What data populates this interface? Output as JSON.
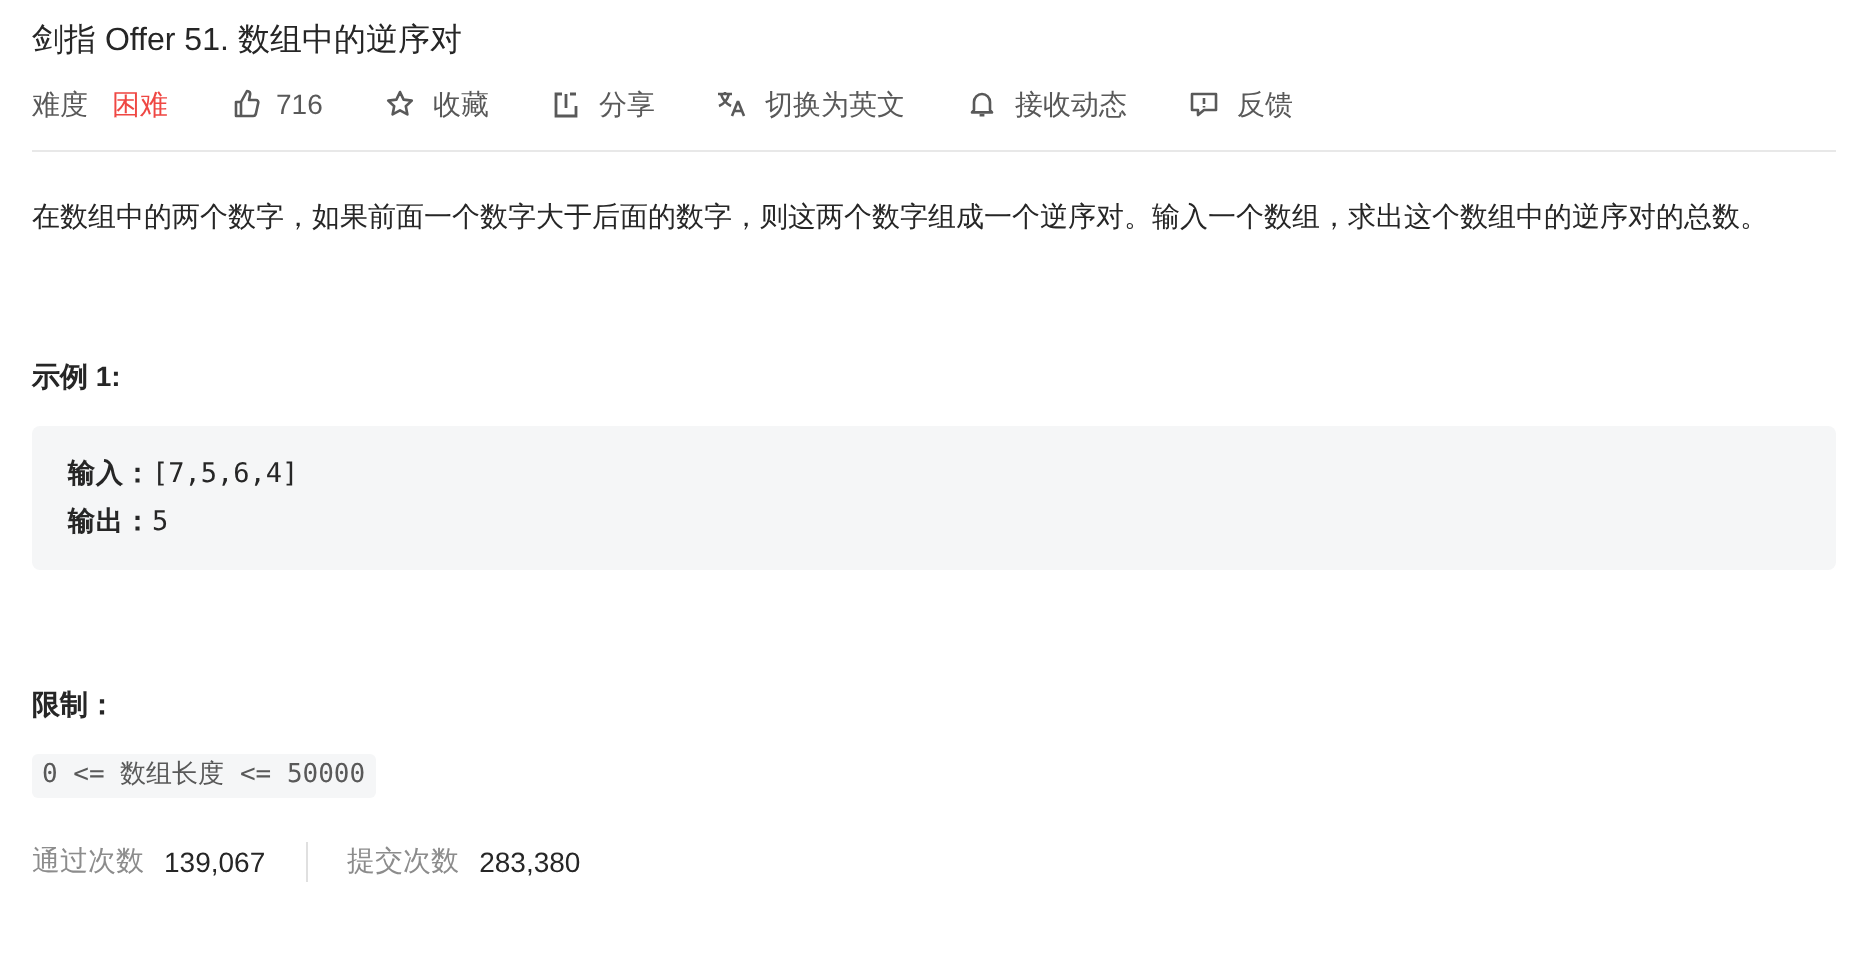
{
  "title": "剑指 Offer 51. 数组中的逆序对",
  "difficulty": {
    "label": "难度",
    "value": "困难",
    "kind": "hard"
  },
  "actions": [
    {
      "kind": "like",
      "label": "716"
    },
    {
      "kind": "star",
      "label": "收藏"
    },
    {
      "kind": "share",
      "label": "分享"
    },
    {
      "kind": "translate",
      "label": "切换为英文"
    },
    {
      "kind": "bell",
      "label": "接收动态"
    },
    {
      "kind": "feedback",
      "label": "反馈"
    }
  ],
  "description": "在数组中的两个数字，如果前面一个数字大于后面的数字，则这两个数字组成一个逆序对。输入一个数组，求出这个数组中的逆序对的总数。",
  "example": {
    "heading": "示例 1:",
    "lines": [
      "**输入：**[7,5,6,4]",
      "**输出：**5"
    ]
  },
  "limits": {
    "heading": "限制：",
    "constraint": "0 <= 数组长度 <= 50000"
  },
  "stats": [
    {
      "label": "通过次数",
      "value": "139,067"
    },
    {
      "label": "提交次数",
      "value": "283,380"
    }
  ]
}
